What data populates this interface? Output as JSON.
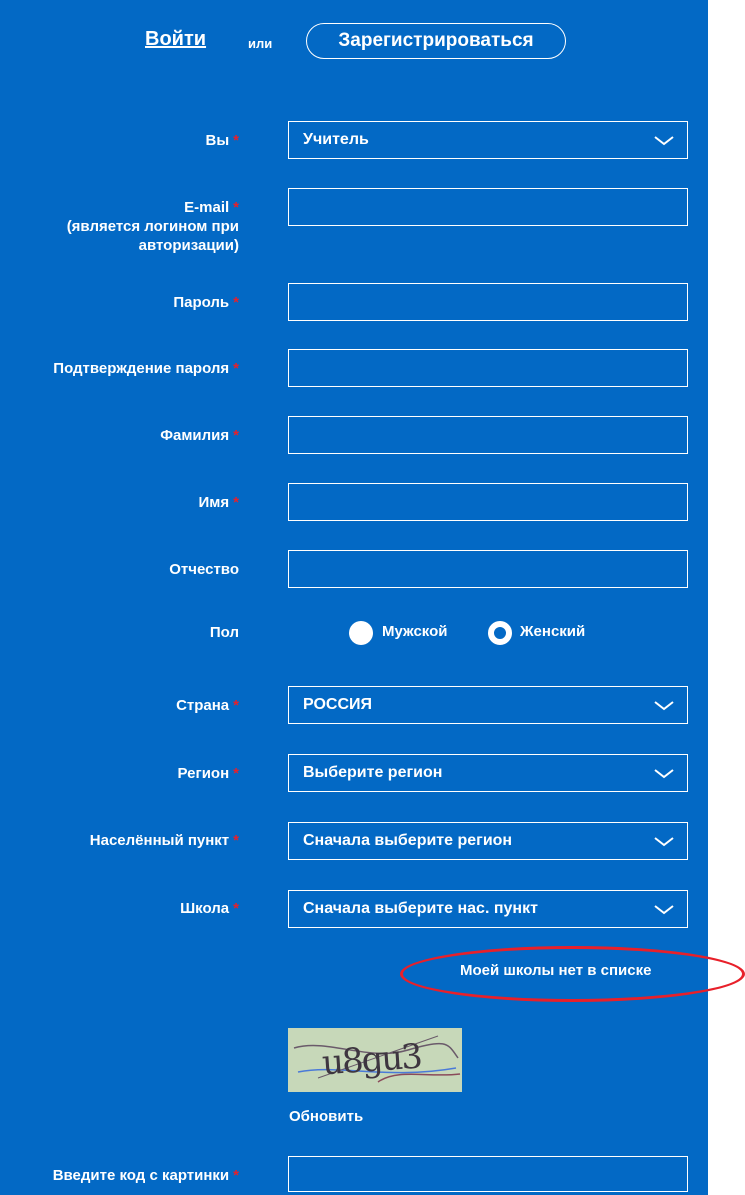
{
  "auth": {
    "login_label": "Войти",
    "or_label": "или",
    "register_label": "Зарегистрироваться"
  },
  "required_marker": "*",
  "form": {
    "role": {
      "label": "Вы",
      "value": "Учитель",
      "icon": "chevron-down-icon"
    },
    "email": {
      "label_line1": "E-mail",
      "label_line2": "(является логином при",
      "label_line3": "авторизации)",
      "value": ""
    },
    "password": {
      "label": "Пароль",
      "value": ""
    },
    "password_confirm": {
      "label": "Подтверждение пароля",
      "value": ""
    },
    "last_name": {
      "label": "Фамилия",
      "value": ""
    },
    "first_name": {
      "label": "Имя",
      "value": ""
    },
    "patronymic": {
      "label": "Отчество",
      "value": ""
    },
    "gender": {
      "label": "Пол",
      "options": [
        "Мужской",
        "Женский"
      ],
      "selected": "Женский"
    },
    "country": {
      "label": "Страна",
      "value": "РОССИЯ"
    },
    "region": {
      "label": "Регион",
      "value": "Выберите регион"
    },
    "locality": {
      "label": "Населённый пункт",
      "value": "Сначала выберите регион"
    },
    "school": {
      "label": "Школа",
      "value": "Сначала выберите нас. пункт"
    },
    "school_missing_link": "Моей школы нет в списке",
    "captcha": {
      "text": "u8gu3",
      "refresh_label": "Обновить",
      "label": "Введите код с картинки",
      "value": ""
    }
  },
  "colors": {
    "background": "#0369c5",
    "required": "#e8202a",
    "annotation": "#e8202a",
    "text": "#ffffff"
  }
}
